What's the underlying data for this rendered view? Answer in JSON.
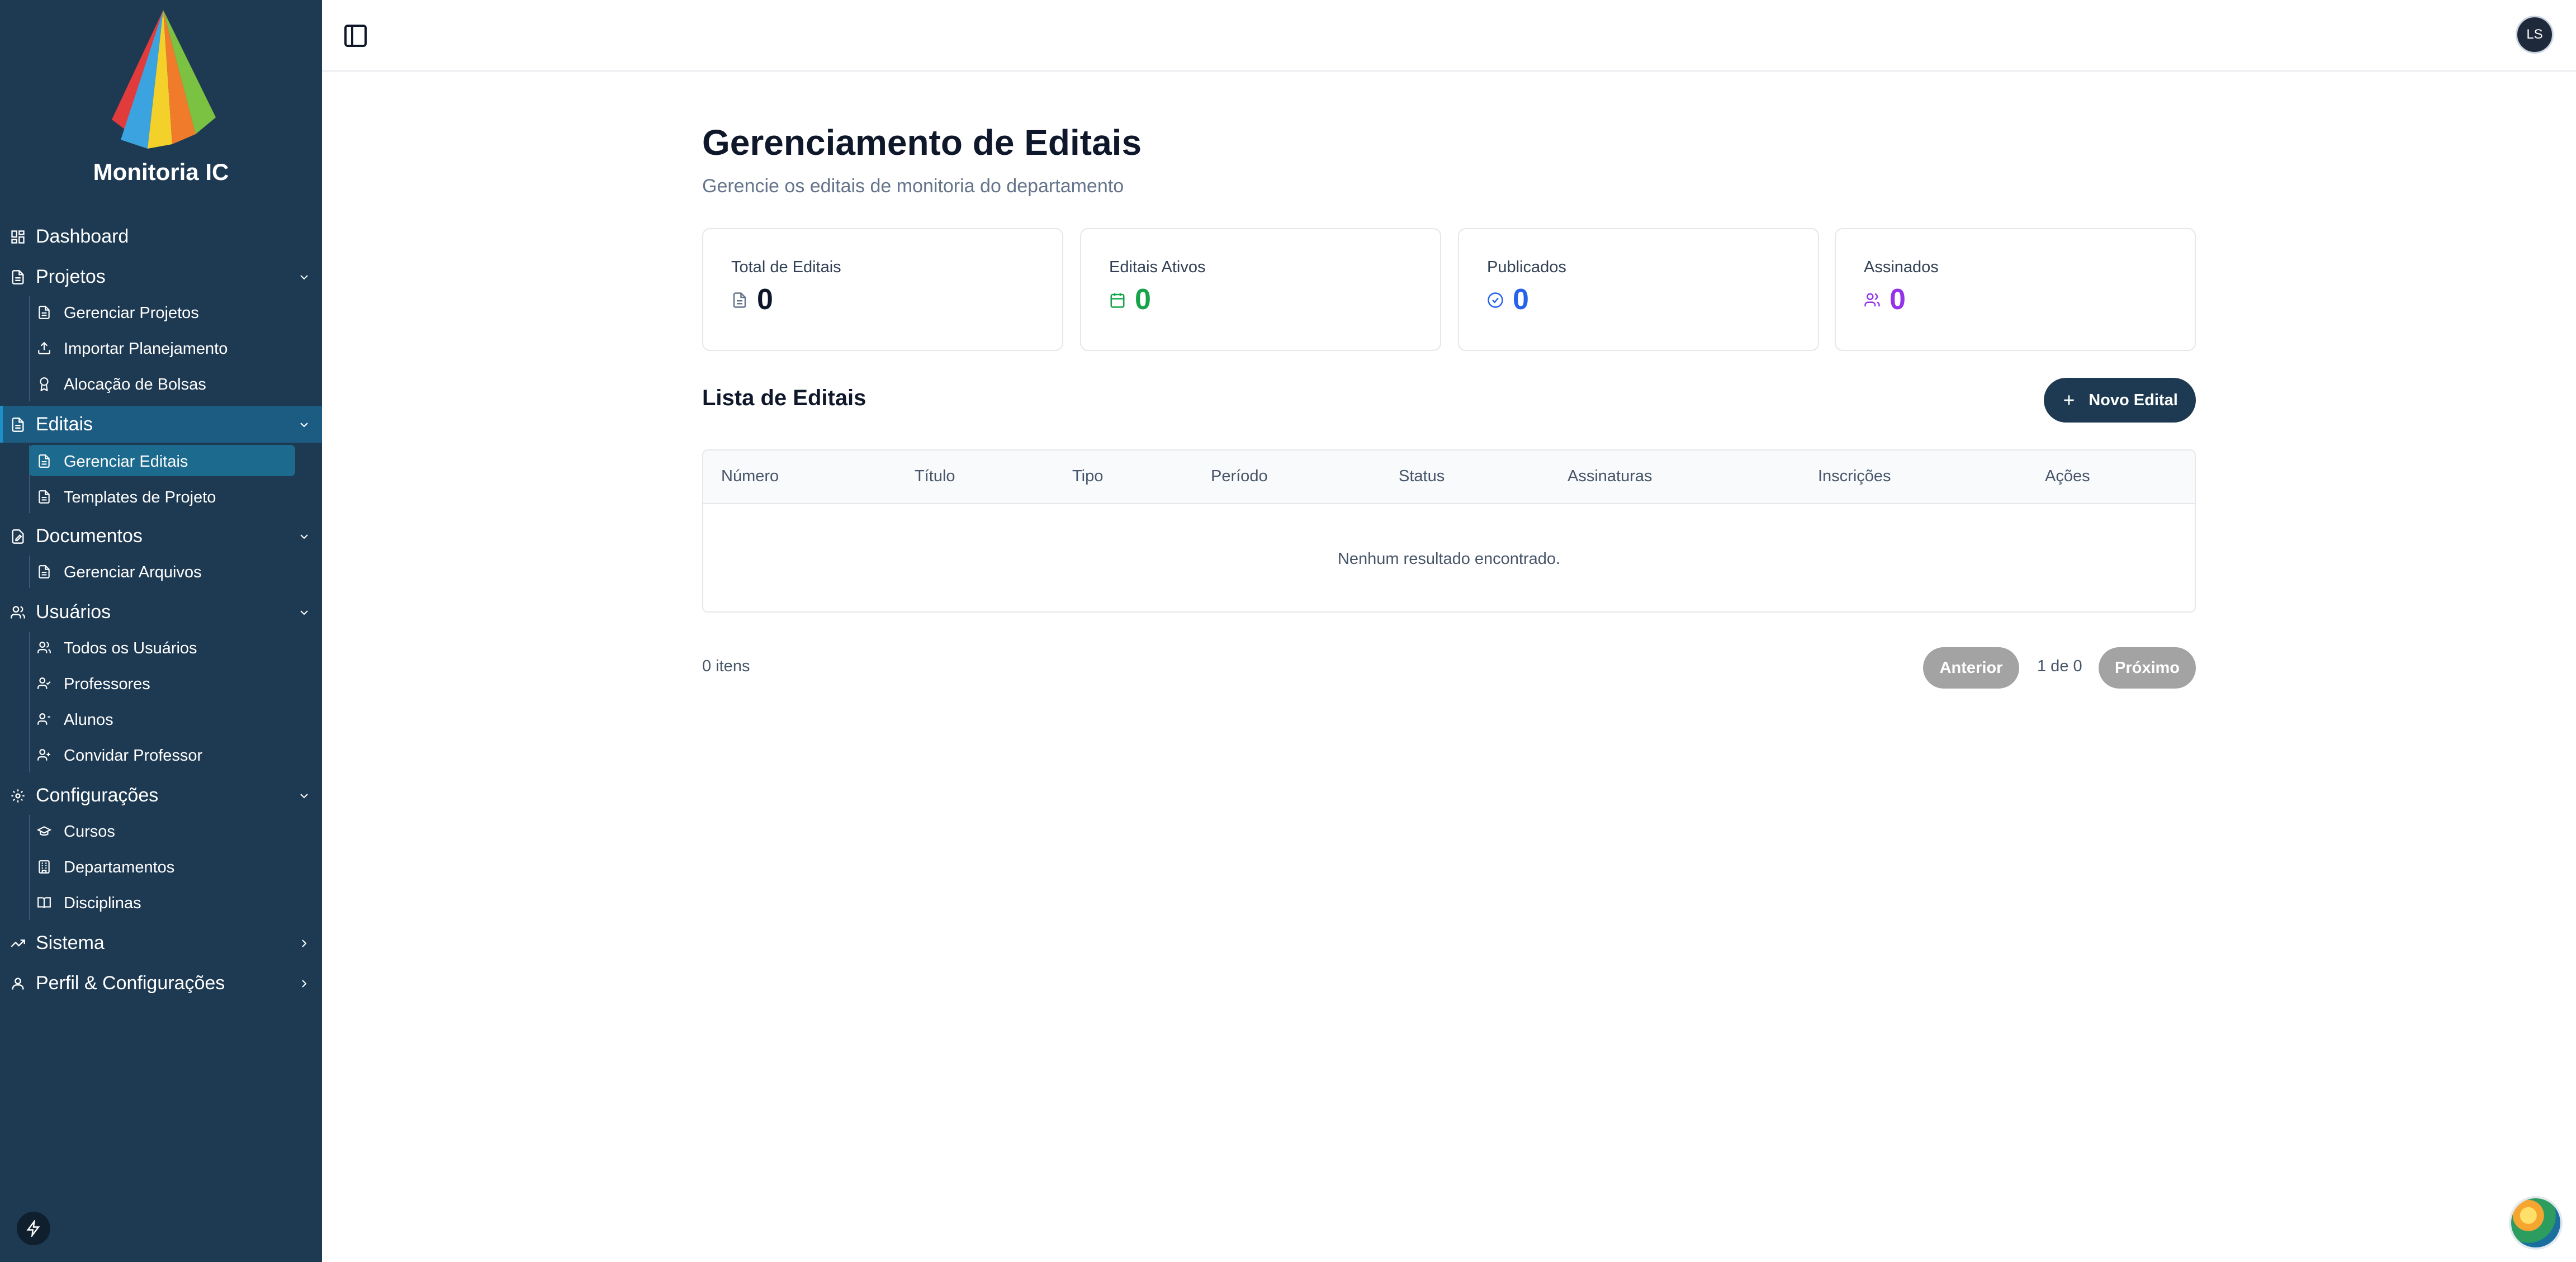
{
  "app": {
    "name": "Monitoria IC"
  },
  "colors": {
    "sidebar_bg": "#1e3a52",
    "accent_active": "#1d5c82",
    "green": "#16a34a",
    "blue": "#2563eb",
    "purple": "#9333ea"
  },
  "sidebar": {
    "dashboard": "Dashboard",
    "projetos": {
      "label": "Projetos",
      "items": [
        "Gerenciar Projetos",
        "Importar Planejamento",
        "Alocação de Bolsas"
      ]
    },
    "editais": {
      "label": "Editais",
      "items": [
        "Gerenciar Editais",
        "Templates de Projeto"
      ]
    },
    "documentos": {
      "label": "Documentos",
      "items": [
        "Gerenciar Arquivos"
      ]
    },
    "usuarios": {
      "label": "Usuários",
      "items": [
        "Todos os Usuários",
        "Professores",
        "Alunos",
        "Convidar Professor"
      ]
    },
    "configuracoes": {
      "label": "Configurações",
      "items": [
        "Cursos",
        "Departamentos",
        "Disciplinas"
      ]
    },
    "sistema": "Sistema",
    "perfil": "Perfil & Configurações"
  },
  "topbar": {
    "avatar_initials": "LS"
  },
  "page": {
    "title": "Gerenciamento de Editais",
    "subtitle": "Gerencie os editais de monitoria do departamento"
  },
  "stats": [
    {
      "label": "Total de Editais",
      "value": "0",
      "icon": "file-icon"
    },
    {
      "label": "Editais Ativos",
      "value": "0",
      "icon": "calendar-icon"
    },
    {
      "label": "Publicados",
      "value": "0",
      "icon": "check-circle-icon"
    },
    {
      "label": "Assinados",
      "value": "0",
      "icon": "users-icon"
    }
  ],
  "list": {
    "title": "Lista de Editais",
    "new_button": "Novo Edital",
    "columns": [
      "Número",
      "Título",
      "Tipo",
      "Período",
      "Status",
      "Assinaturas",
      "Inscrições",
      "Ações"
    ],
    "empty_message": "Nenhum resultado encontrado."
  },
  "pagination": {
    "items_count": "0 itens",
    "prev": "Anterior",
    "page_info": "1 de 0",
    "next": "Próximo"
  }
}
